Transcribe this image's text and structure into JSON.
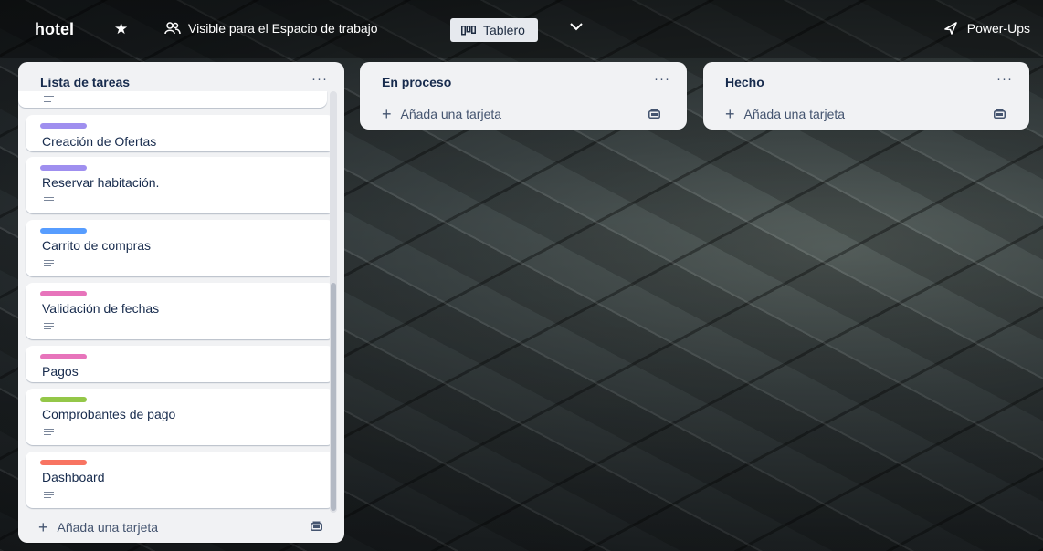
{
  "board": {
    "title": "hotel",
    "visibility_label": "Visible para el Espacio de trabajo",
    "view_label": "Tablero",
    "power_ups_label": "Power-Ups"
  },
  "icons": {
    "star": "star-icon",
    "visibility": "people-icon",
    "board_view": "board-view-icon",
    "chevron": "chevron-down-icon",
    "power_ups": "rocket-icon",
    "menu": "ellipsis-icon",
    "add": "plus-icon",
    "template": "template-icon",
    "description": "description-icon"
  },
  "colors": {
    "purple": "#9f8fef",
    "blue": "#579dff",
    "pink": "#e774bb",
    "green": "#94c748",
    "red": "#f87462",
    "list_bg": "#f1f2f4"
  },
  "lists": [
    {
      "title": "Lista de tareas",
      "menu_label": "···",
      "add_label": "Añada una tarjeta",
      "cards": [
        {
          "title": "Creación de Ofertas",
          "label_color": "#9f8fef",
          "has_description": false
        },
        {
          "title": "Reservar habitación.",
          "label_color": "#9f8fef",
          "has_description": true
        },
        {
          "title": "Carrito de compras",
          "label_color": "#579dff",
          "has_description": true
        },
        {
          "title": "Validación de fechas",
          "label_color": "#e774bb",
          "has_description": true
        },
        {
          "title": "Pagos",
          "label_color": "#e774bb",
          "has_description": false
        },
        {
          "title": "Comprobantes de pago",
          "label_color": "#94c748",
          "has_description": true
        },
        {
          "title": "Dashboard",
          "label_color": "#f87462",
          "has_description": true
        }
      ]
    },
    {
      "title": "En proceso",
      "menu_label": "···",
      "add_label": "Añada una tarjeta",
      "cards": []
    },
    {
      "title": "Hecho",
      "menu_label": "···",
      "add_label": "Añada una tarjeta",
      "cards": []
    }
  ]
}
